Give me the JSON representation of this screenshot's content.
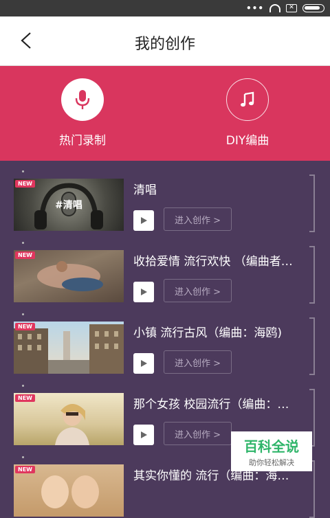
{
  "header": {
    "title": "我的创作"
  },
  "banner": {
    "left_label": "热门录制",
    "right_label": "DIY编曲",
    "color": "#d9365e"
  },
  "items": [
    {
      "title": "清唱",
      "thumb_label": "#清唱",
      "badge": "NEW",
      "button": "进入创作 >"
    },
    {
      "title": "收拾爱情 流行欢快 （编曲者…",
      "badge": "NEW",
      "button": "进入创作 >"
    },
    {
      "title": "小镇 流行古风（编曲：海鸥)",
      "badge": "NEW",
      "button": "进入创作 >"
    },
    {
      "title": "那个女孩 校园流行（编曲：…",
      "badge": "NEW",
      "button": "进入创作 >"
    },
    {
      "title": "其实你懂的 流行（编曲：海…",
      "badge": "NEW",
      "button": ""
    }
  ],
  "watermark": {
    "title": "百科全说",
    "subtitle": "助你轻松解决"
  }
}
